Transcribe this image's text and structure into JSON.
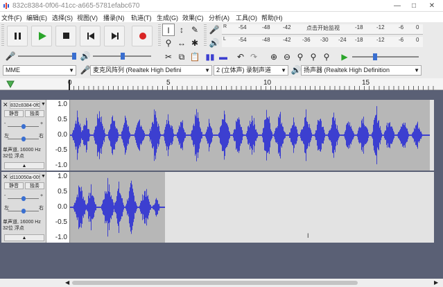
{
  "window": {
    "title": "832c8384-0f06-41cc-a665-5781efabc670",
    "minimize_icon": "minimize-icon",
    "maximize_icon": "maximize-icon",
    "close_icon": "close-icon"
  },
  "menu": [
    "文件(F)",
    "编辑(E)",
    "选择(S)",
    "视图(V)",
    "播录(N)",
    "轨道(T)",
    "生成(G)",
    "效果(C)",
    "分析(A)",
    "工具(O)",
    "帮助(H)"
  ],
  "transport": {
    "buttons": [
      "pause-icon",
      "play-icon",
      "stop-icon",
      "skip-to-start-icon",
      "skip-to-end-icon",
      "record-icon"
    ]
  },
  "meters": {
    "record_ticks": [
      "-54",
      "-48",
      "-42",
      "点击开始监视",
      "-18",
      "-12",
      "-6",
      "0"
    ],
    "play_ticks": [
      "-54",
      "-48",
      "-42",
      "-36",
      "-30",
      "-24",
      "-18",
      "-12",
      "-6",
      "0"
    ],
    "record_label": "R",
    "play_label": "L"
  },
  "devices": {
    "host": "MME",
    "recording_device": "麦克风阵列 (Realtek High Defini",
    "channels": "2 (立体声) 录制声道",
    "playback_device": "扬声器 (Realtek High Definition"
  },
  "timeline": {
    "labels": [
      "0",
      "5",
      "10",
      "15"
    ]
  },
  "tracks": [
    {
      "name": "832c8384-0f0",
      "mute_label": "静音",
      "solo_label": "独奏",
      "gain_minus": "-",
      "gain_plus": "+",
      "pan_left": "左",
      "pan_right": "右",
      "info_line1": "单声道, 16000 Hz",
      "info_line2": "32位 浮点",
      "y_labels": [
        "1.0",
        "0.5",
        "0.0",
        "-0.5",
        "-1.0"
      ]
    },
    {
      "name": "d110050a-009",
      "mute_label": "静音",
      "solo_label": "独奏",
      "gain_minus": "-",
      "gain_plus": "+",
      "pan_left": "左",
      "pan_right": "右",
      "info_line1": "单声道, 16000 Hz",
      "info_line2": "32位 浮点",
      "y_labels": [
        "1.0",
        "0.5",
        "0.0",
        "-0.5",
        "-1.0"
      ]
    }
  ],
  "colors": {
    "waveform": "#3c3fd0",
    "clip_bg": "#b7b7b7",
    "record_red": "#d92626",
    "play_green": "#2aa52a",
    "track_area_bg": "#5a6075"
  }
}
